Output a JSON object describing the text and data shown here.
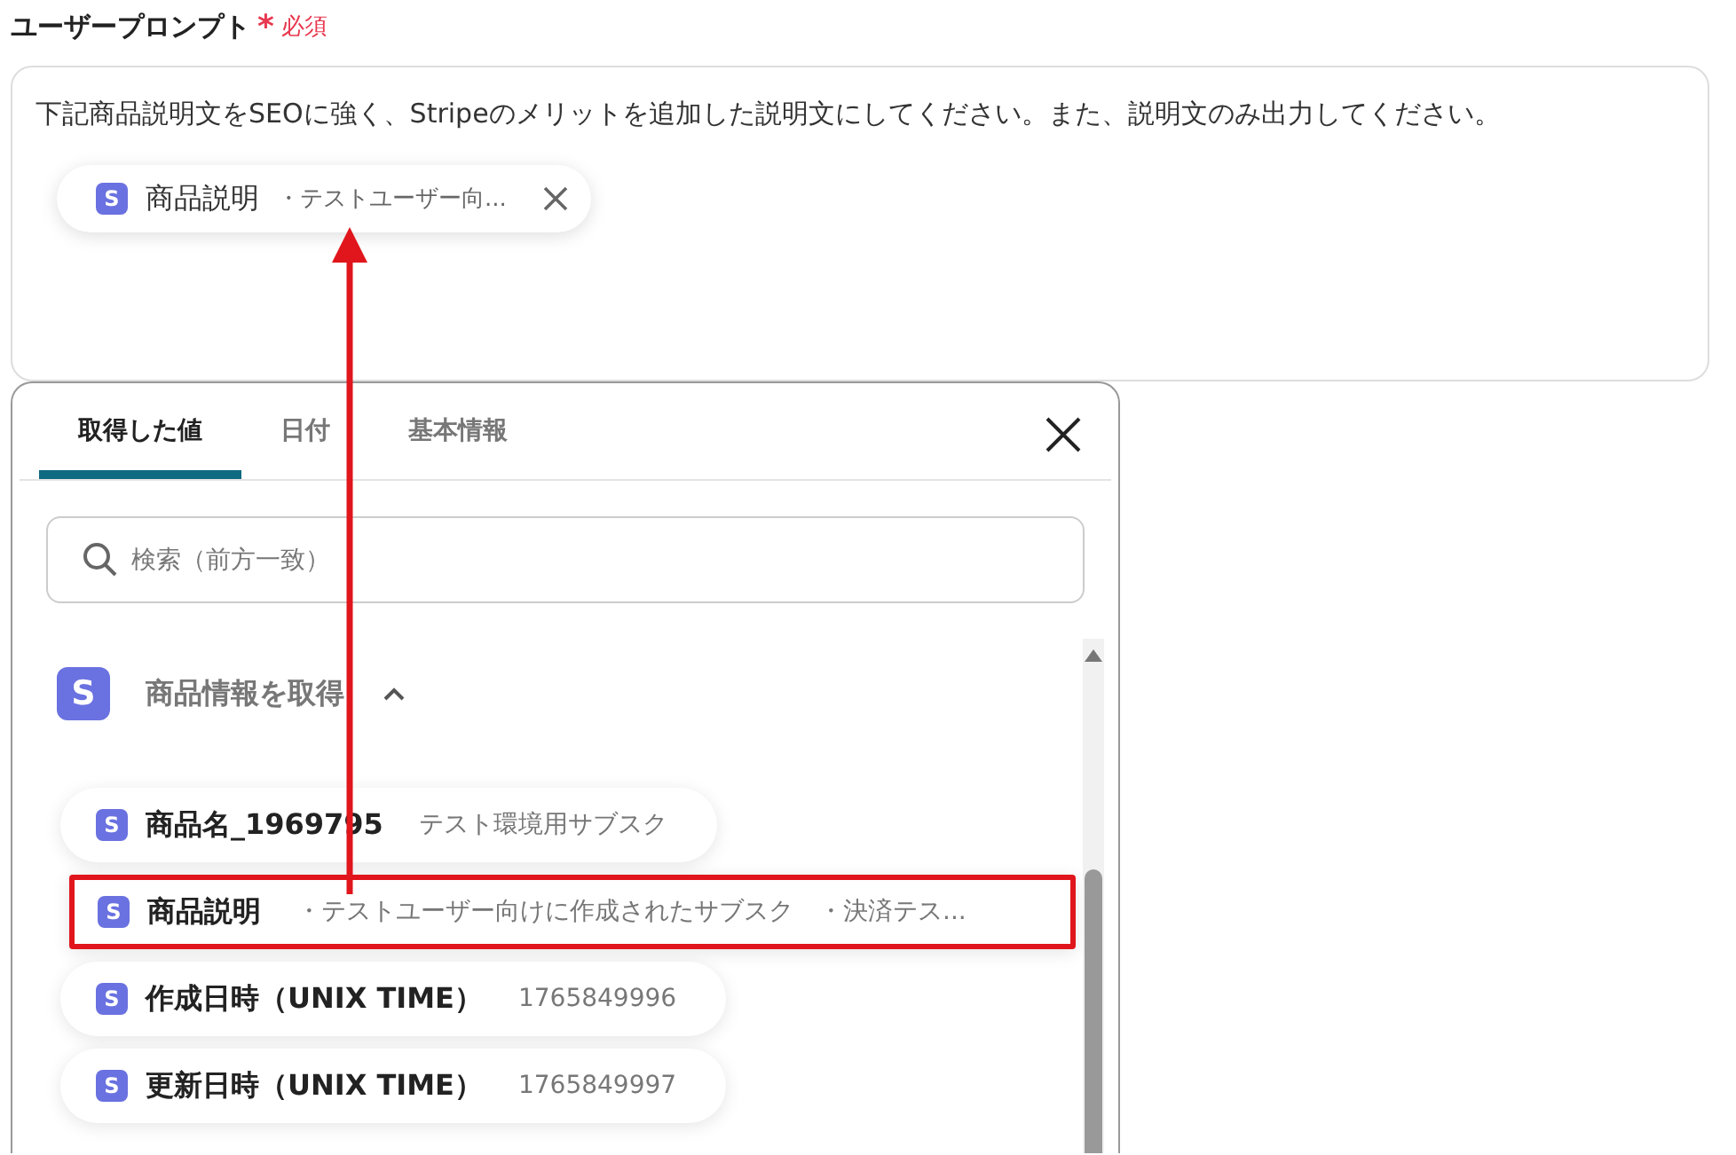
{
  "field": {
    "label": "ユーザープロンプト",
    "required_mark": "*",
    "required_label": "必須"
  },
  "prompt": {
    "text": "下記商品説明文をSEOに強く、Stripeのメリットを追加した説明文にしてください。また、説明文のみ出力してください。",
    "chip": {
      "icon_letter": "S",
      "label": "商品説明",
      "value": "・テストユーザー向..."
    }
  },
  "picker": {
    "tabs": [
      {
        "label": "取得した値",
        "selected": true
      },
      {
        "label": "日付",
        "selected": false
      },
      {
        "label": "基本情報",
        "selected": false
      }
    ],
    "search": {
      "placeholder": "検索（前方一致）"
    },
    "group": {
      "icon_letter": "S",
      "title": "商品情報を取得",
      "expanded": true
    },
    "items": [
      {
        "icon_letter": "S",
        "label": "商品名_1969795",
        "value": "テスト環境用サブスク",
        "highlighted": false
      },
      {
        "icon_letter": "S",
        "label": "商品説明",
        "value": "・テストユーザー向けに作成されたサブスク　・決済テス...",
        "highlighted": true
      },
      {
        "icon_letter": "S",
        "label": "作成日時（UNIX TIME）",
        "value": "1765849996",
        "highlighted": false
      },
      {
        "icon_letter": "S",
        "label": "更新日時（UNIX TIME）",
        "value": "1765849997",
        "highlighted": false
      }
    ]
  }
}
